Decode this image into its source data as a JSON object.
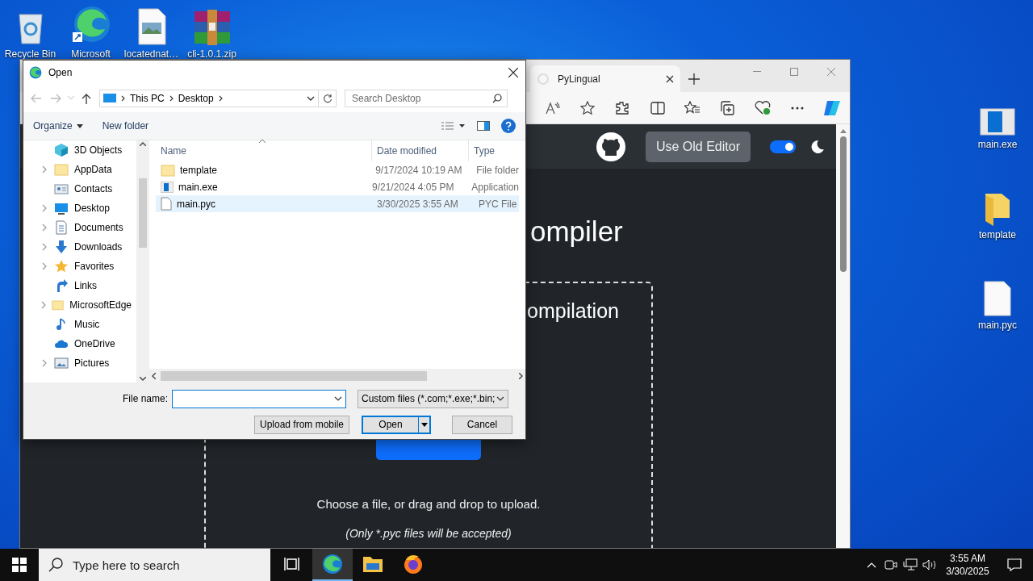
{
  "desktop_top": [
    {
      "label": "Recycle Bin",
      "kind": "recycle"
    },
    {
      "label": "Microsoft",
      "kind": "edge"
    },
    {
      "label": "locatednat…",
      "kind": "image"
    },
    {
      "label": "cli-1.0.1.zip",
      "kind": "archive"
    }
  ],
  "desktop_right": [
    {
      "label": "main.exe",
      "kind": "exe"
    },
    {
      "label": "template",
      "kind": "folder"
    },
    {
      "label": "main.pyc",
      "kind": "file"
    }
  ],
  "browser": {
    "tab_title": "PyLingual",
    "page": {
      "nav_button": "Use Old Editor",
      "theme_toggle": {
        "on": true
      },
      "heading": "ompiler",
      "subheading": "ompilation",
      "hint": "Choose a file, or drag and drop to upload.",
      "note": "(Only *.pyc files will be accepted)"
    }
  },
  "dialog": {
    "title": "Open",
    "breadcrumb": [
      "This PC",
      "Desktop"
    ],
    "search_placeholder": "Search Desktop",
    "commands": [
      "Organize",
      "New folder"
    ],
    "nav_items": [
      {
        "label": "3D Objects",
        "kind": "objects",
        "expandable": false
      },
      {
        "label": "AppData",
        "kind": "folder",
        "expandable": true
      },
      {
        "label": "Contacts",
        "kind": "contacts",
        "expandable": false
      },
      {
        "label": "Desktop",
        "kind": "desktop",
        "expandable": true
      },
      {
        "label": "Documents",
        "kind": "documents",
        "expandable": true
      },
      {
        "label": "Downloads",
        "kind": "downloads",
        "expandable": true
      },
      {
        "label": "Favorites",
        "kind": "star",
        "expandable": true
      },
      {
        "label": "Links",
        "kind": "links",
        "expandable": false
      },
      {
        "label": "MicrosoftEdge",
        "kind": "folder",
        "expandable": true
      },
      {
        "label": "Music",
        "kind": "music",
        "expandable": false
      },
      {
        "label": "OneDrive",
        "kind": "cloud",
        "expandable": false
      },
      {
        "label": "Pictures",
        "kind": "pictures",
        "expandable": true
      }
    ],
    "columns": [
      "Name",
      "Date modified",
      "Type"
    ],
    "files": [
      {
        "name": "template",
        "date": "9/17/2024 10:19 AM",
        "type": "File folder",
        "kind": "folder",
        "selected": false
      },
      {
        "name": "main.exe",
        "date": "9/21/2024 4:05 PM",
        "type": "Application",
        "kind": "exe",
        "selected": false
      },
      {
        "name": "main.pyc",
        "date": "3/30/2025 3:55 AM",
        "type": "PYC File",
        "kind": "file",
        "selected": true
      }
    ],
    "file_name_label": "File name:",
    "filter": "Custom files (*.com;*.exe;*.bin;",
    "buttons": [
      "Upload from mobile",
      "Open",
      "Cancel"
    ]
  },
  "taskbar": {
    "search_placeholder": "Type here to search",
    "apps": [
      {
        "kind": "taskview",
        "active": false
      },
      {
        "kind": "edge",
        "active": true
      },
      {
        "kind": "explorer",
        "active": false
      },
      {
        "kind": "firefox",
        "active": false
      }
    ],
    "time": "3:55 AM",
    "date": "3/30/2025"
  }
}
